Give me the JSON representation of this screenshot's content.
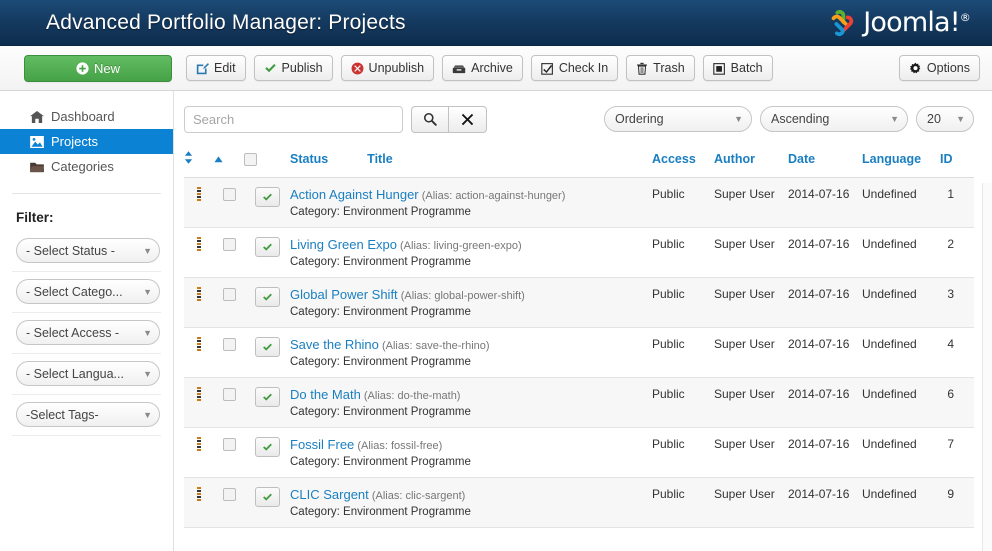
{
  "header": {
    "title": "Advanced Portfolio Manager: Projects",
    "brand": "Joomla!",
    "brand_sup": "®",
    "brand_icon": "joomla-logo-icon"
  },
  "toolbar": {
    "buttons": [
      {
        "label": "New",
        "icon": "plus-circle-icon"
      },
      {
        "label": "Edit",
        "icon": "pencil-square-icon"
      },
      {
        "label": "Publish",
        "icon": "check-icon"
      },
      {
        "label": "Unpublish",
        "icon": "times-circle-icon"
      },
      {
        "label": "Archive",
        "icon": "archive-box-icon"
      },
      {
        "label": "Check In",
        "icon": "checkbox-checked-icon"
      },
      {
        "label": "Trash",
        "icon": "trash-icon"
      },
      {
        "label": "Batch",
        "icon": "batch-square-icon"
      }
    ],
    "options": {
      "label": "Options",
      "icon": "gear-icon"
    }
  },
  "sidebar": {
    "nav": [
      {
        "label": "Dashboard",
        "icon": "home-icon",
        "active": false
      },
      {
        "label": "Projects",
        "icon": "picture-icon",
        "active": true
      },
      {
        "label": "Categories",
        "icon": "folder-open-icon",
        "active": false
      }
    ],
    "filter_heading": "Filter:",
    "filters": [
      {
        "label": "- Select Status -",
        "icon": "chevron-down-icon"
      },
      {
        "label": "- Select Catego...",
        "icon": "chevron-down-icon"
      },
      {
        "label": "- Select Access -",
        "icon": "chevron-down-icon"
      },
      {
        "label": "- Select Langua...",
        "icon": "chevron-down-icon"
      },
      {
        "label": "-Select Tags-",
        "icon": "chevron-down-icon"
      }
    ]
  },
  "search": {
    "placeholder": "Search",
    "value": "",
    "search_icon": "search-icon",
    "clear_icon": "close-x-icon"
  },
  "list_controls": {
    "ordering": "Ordering",
    "direction": "Ascending",
    "limit": "20"
  },
  "table": {
    "headers": {
      "sort": "sort-icon",
      "sort_asc": "sort-asc-icon",
      "check_all": "select-all-checkbox",
      "status": "Status",
      "title": "Title",
      "access": "Access",
      "author": "Author",
      "date": "Date",
      "language": "Language",
      "id": "ID"
    },
    "alias_prefix": "(Alias: ",
    "alias_suffix": ")",
    "category_prefix": "Category: ",
    "rows": [
      {
        "title": "Action Against Hunger",
        "alias": "action-against-hunger",
        "category": "Environment Programme",
        "status": "published",
        "access": "Public",
        "author": "Super User",
        "date": "2014-07-16",
        "language": "Undefined",
        "id": "1"
      },
      {
        "title": "Living Green Expo",
        "alias": "living-green-expo",
        "category": "Environment Programme",
        "status": "published",
        "access": "Public",
        "author": "Super User",
        "date": "2014-07-16",
        "language": "Undefined",
        "id": "2"
      },
      {
        "title": "Global Power Shift",
        "alias": "global-power-shift",
        "category": "Environment Programme",
        "status": "published",
        "access": "Public",
        "author": "Super User",
        "date": "2014-07-16",
        "language": "Undefined",
        "id": "3"
      },
      {
        "title": "Save the Rhino",
        "alias": "save-the-rhino",
        "category": "Environment Programme",
        "status": "published",
        "access": "Public",
        "author": "Super User",
        "date": "2014-07-16",
        "language": "Undefined",
        "id": "4"
      },
      {
        "title": "Do the Math",
        "alias": "do-the-math",
        "category": "Environment Programme",
        "status": "published",
        "access": "Public",
        "author": "Super User",
        "date": "2014-07-16",
        "language": "Undefined",
        "id": "6"
      },
      {
        "title": "Fossil Free",
        "alias": "fossil-free",
        "category": "Environment Programme",
        "status": "published",
        "access": "Public",
        "author": "Super User",
        "date": "2014-07-16",
        "language": "Undefined",
        "id": "7"
      },
      {
        "title": "CLIC Sargent",
        "alias": "clic-sargent",
        "category": "Environment Programme",
        "status": "published",
        "access": "Public",
        "author": "Super User",
        "date": "2014-07-16",
        "language": "Undefined",
        "id": "9"
      }
    ]
  },
  "colors": {
    "header_blue": "#14395e",
    "accent_blue": "#1a7fc1",
    "active_blue": "#0b82d4",
    "new_green": "#46a246",
    "status_green": "#3f9b3f",
    "unpublish_red": "#cc3333"
  }
}
